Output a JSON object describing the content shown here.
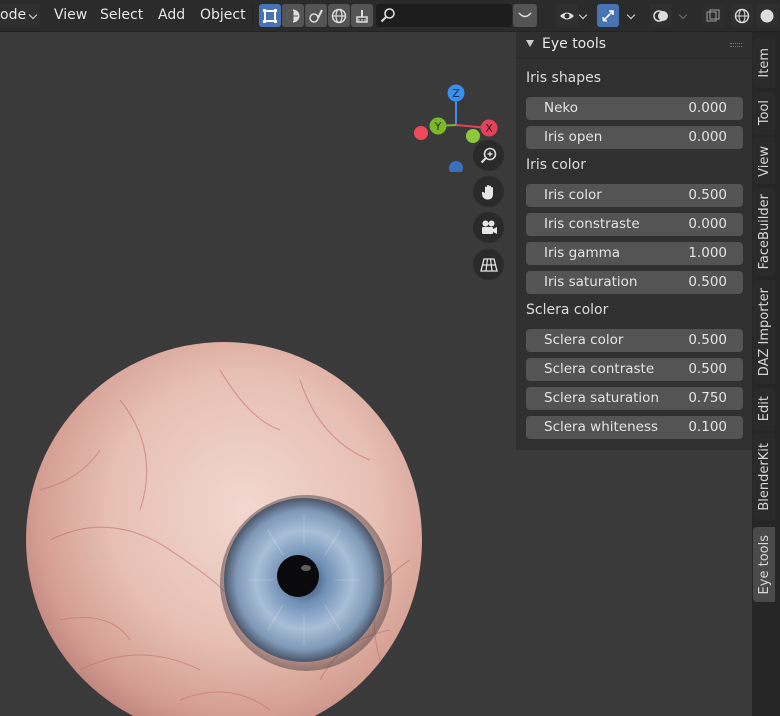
{
  "header": {
    "mode_label": "ode",
    "menu": [
      "View",
      "Select",
      "Add",
      "Object"
    ],
    "search_placeholder": ""
  },
  "gizmo": {
    "x": "X",
    "y": "Y",
    "z": "Z"
  },
  "panel": {
    "title": "Eye tools",
    "sections": [
      {
        "title": "Iris shapes",
        "fields": [
          {
            "label": "Neko",
            "value": "0.000"
          },
          {
            "label": "Iris open",
            "value": "0.000"
          }
        ]
      },
      {
        "title": "Iris color",
        "fields": [
          {
            "label": "Iris color",
            "value": "0.500"
          },
          {
            "label": "Iris constraste",
            "value": "0.000"
          },
          {
            "label": "Iris gamma",
            "value": "1.000"
          },
          {
            "label": "Iris saturation",
            "value": "0.500"
          }
        ]
      },
      {
        "title": "Sclera color",
        "fields": [
          {
            "label": "Sclera color",
            "value": "0.500"
          },
          {
            "label": "Sclera contraste",
            "value": "0.500"
          },
          {
            "label": "Sclera saturation",
            "value": "0.750"
          },
          {
            "label": "Sclera whiteness",
            "value": "0.100"
          }
        ]
      }
    ]
  },
  "tabs": [
    {
      "label": "Item",
      "active": false
    },
    {
      "label": "Tool",
      "active": false
    },
    {
      "label": "View",
      "active": false
    },
    {
      "label": "FaceBuilder",
      "active": false
    },
    {
      "label": "DAZ Importer",
      "active": false
    },
    {
      "label": "Edit",
      "active": false
    },
    {
      "label": "BlenderKit",
      "active": false
    },
    {
      "label": "Eye tools",
      "active": true
    }
  ],
  "colors": {
    "accent": "#4772b3",
    "axis_x": "#e0435a",
    "axis_y": "#7bb62b",
    "axis_z": "#3a8ff0"
  }
}
